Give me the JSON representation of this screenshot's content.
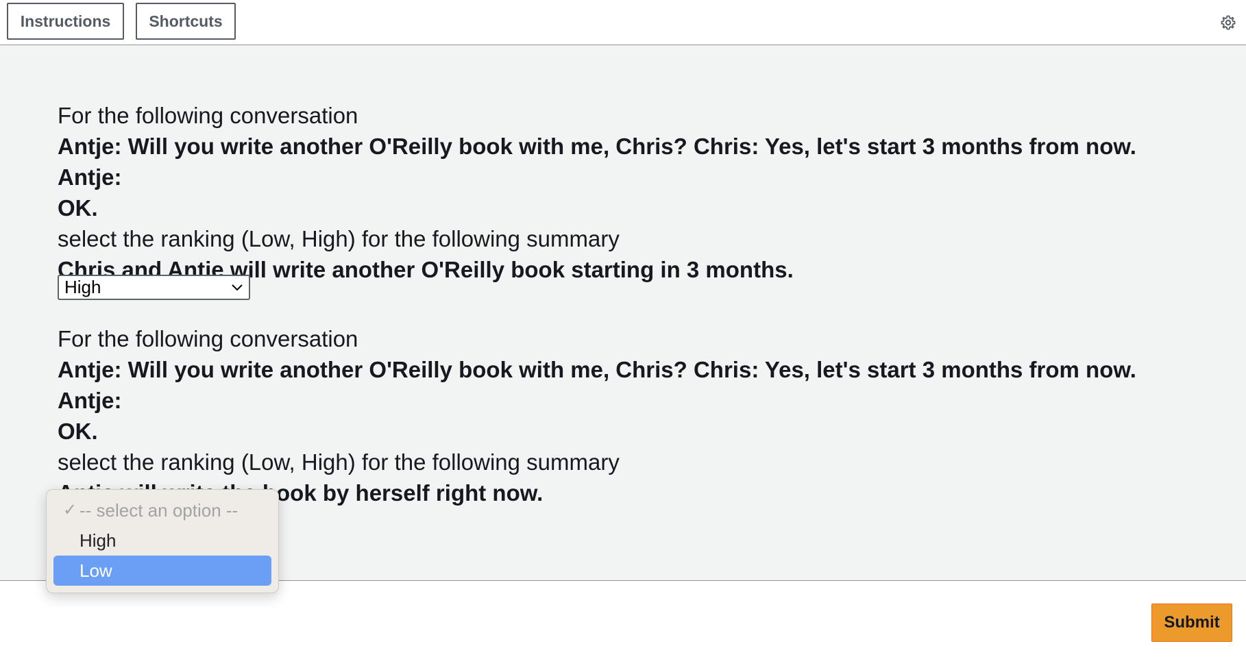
{
  "header": {
    "instructions_label": "Instructions",
    "shortcuts_label": "Shortcuts",
    "settings_icon": "gear-icon"
  },
  "items": [
    {
      "prompt": "For the following conversation",
      "conversation_line1": "Antje: Will you write another O'Reilly book with me, Chris? Chris: Yes, let's start 3 months from now. Antje:",
      "conversation_line2": "OK.",
      "instruction": "select the ranking (Low, High) for the following summary",
      "summary": "Chris and Antje will write another O'Reilly book starting in 3 months.",
      "selected_value": "High"
    },
    {
      "prompt": "For the following conversation",
      "conversation_line1": "Antje: Will you write another O'Reilly book with me, Chris? Chris: Yes, let's start 3 months from now. Antje:",
      "conversation_line2": "OK.",
      "instruction": "select the ranking (Low, High) for the following summary",
      "summary": "Antje will write the book by herself right now."
    }
  ],
  "dropdown": {
    "check_mark": "✓",
    "placeholder": "-- select an option --",
    "options": [
      "High",
      "Low"
    ],
    "highlighted": "Low",
    "highlight_color": "#6b9ef5"
  },
  "footer": {
    "submit_label": "Submit",
    "submit_color": "#ec9a2c"
  }
}
